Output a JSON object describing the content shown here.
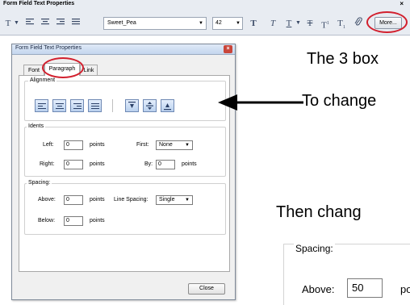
{
  "toolbar": {
    "title": "Form Field Text Properties",
    "close": "×",
    "text_style_icon": "T",
    "font_name": "Sweet_Pea",
    "font_size": "42",
    "more_label": "More..."
  },
  "dialog": {
    "title": "Form Field Text Properties",
    "close": "×",
    "tabs": [
      {
        "label": "Font"
      },
      {
        "label": "Paragraph"
      },
      {
        "label": "Link"
      }
    ],
    "alignment": {
      "label": "Alignment"
    },
    "idents": {
      "label": "Idents",
      "left_label": "Left:",
      "left_value": "0",
      "left_unit": "points",
      "right_label": "Right:",
      "right_value": "0",
      "right_unit": "points",
      "first_label": "First:",
      "first_value": "None",
      "by_label": "By:",
      "by_value": "0",
      "by_unit": "points"
    },
    "spacing": {
      "label": "Spacing:",
      "above_label": "Above:",
      "above_value": "0",
      "above_unit": "points",
      "line_spacing_label": "Line Spacing:",
      "line_spacing_value": "Single",
      "below_label": "Below:",
      "below_value": "0",
      "below_unit": "points"
    },
    "close_label": "Close"
  },
  "annotations": {
    "line1": "The 3 box",
    "line2": "To change",
    "line3": "Then chang"
  },
  "inset": {
    "label": "Spacing:",
    "above_label": "Above:",
    "above_value": "50",
    "above_unit": "po"
  },
  "colors": {
    "highlight_ring": "#d2202e",
    "toolbar_bg": "#e8ecf2",
    "dialog_bg": "#f0f0f0"
  }
}
